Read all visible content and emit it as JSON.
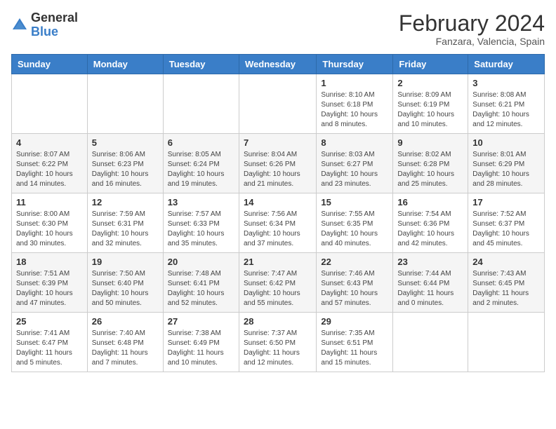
{
  "header": {
    "logo_general": "General",
    "logo_blue": "Blue",
    "month_year": "February 2024",
    "location": "Fanzara, Valencia, Spain"
  },
  "days_of_week": [
    "Sunday",
    "Monday",
    "Tuesday",
    "Wednesday",
    "Thursday",
    "Friday",
    "Saturday"
  ],
  "weeks": [
    [
      {
        "day": "",
        "sunrise": "",
        "sunset": "",
        "daylight": ""
      },
      {
        "day": "",
        "sunrise": "",
        "sunset": "",
        "daylight": ""
      },
      {
        "day": "",
        "sunrise": "",
        "sunset": "",
        "daylight": ""
      },
      {
        "day": "",
        "sunrise": "",
        "sunset": "",
        "daylight": ""
      },
      {
        "day": "1",
        "sunrise": "Sunrise: 8:10 AM",
        "sunset": "Sunset: 6:18 PM",
        "daylight": "Daylight: 10 hours and 8 minutes."
      },
      {
        "day": "2",
        "sunrise": "Sunrise: 8:09 AM",
        "sunset": "Sunset: 6:19 PM",
        "daylight": "Daylight: 10 hours and 10 minutes."
      },
      {
        "day": "3",
        "sunrise": "Sunrise: 8:08 AM",
        "sunset": "Sunset: 6:21 PM",
        "daylight": "Daylight: 10 hours and 12 minutes."
      }
    ],
    [
      {
        "day": "4",
        "sunrise": "Sunrise: 8:07 AM",
        "sunset": "Sunset: 6:22 PM",
        "daylight": "Daylight: 10 hours and 14 minutes."
      },
      {
        "day": "5",
        "sunrise": "Sunrise: 8:06 AM",
        "sunset": "Sunset: 6:23 PM",
        "daylight": "Daylight: 10 hours and 16 minutes."
      },
      {
        "day": "6",
        "sunrise": "Sunrise: 8:05 AM",
        "sunset": "Sunset: 6:24 PM",
        "daylight": "Daylight: 10 hours and 19 minutes."
      },
      {
        "day": "7",
        "sunrise": "Sunrise: 8:04 AM",
        "sunset": "Sunset: 6:26 PM",
        "daylight": "Daylight: 10 hours and 21 minutes."
      },
      {
        "day": "8",
        "sunrise": "Sunrise: 8:03 AM",
        "sunset": "Sunset: 6:27 PM",
        "daylight": "Daylight: 10 hours and 23 minutes."
      },
      {
        "day": "9",
        "sunrise": "Sunrise: 8:02 AM",
        "sunset": "Sunset: 6:28 PM",
        "daylight": "Daylight: 10 hours and 25 minutes."
      },
      {
        "day": "10",
        "sunrise": "Sunrise: 8:01 AM",
        "sunset": "Sunset: 6:29 PM",
        "daylight": "Daylight: 10 hours and 28 minutes."
      }
    ],
    [
      {
        "day": "11",
        "sunrise": "Sunrise: 8:00 AM",
        "sunset": "Sunset: 6:30 PM",
        "daylight": "Daylight: 10 hours and 30 minutes."
      },
      {
        "day": "12",
        "sunrise": "Sunrise: 7:59 AM",
        "sunset": "Sunset: 6:31 PM",
        "daylight": "Daylight: 10 hours and 32 minutes."
      },
      {
        "day": "13",
        "sunrise": "Sunrise: 7:57 AM",
        "sunset": "Sunset: 6:33 PM",
        "daylight": "Daylight: 10 hours and 35 minutes."
      },
      {
        "day": "14",
        "sunrise": "Sunrise: 7:56 AM",
        "sunset": "Sunset: 6:34 PM",
        "daylight": "Daylight: 10 hours and 37 minutes."
      },
      {
        "day": "15",
        "sunrise": "Sunrise: 7:55 AM",
        "sunset": "Sunset: 6:35 PM",
        "daylight": "Daylight: 10 hours and 40 minutes."
      },
      {
        "day": "16",
        "sunrise": "Sunrise: 7:54 AM",
        "sunset": "Sunset: 6:36 PM",
        "daylight": "Daylight: 10 hours and 42 minutes."
      },
      {
        "day": "17",
        "sunrise": "Sunrise: 7:52 AM",
        "sunset": "Sunset: 6:37 PM",
        "daylight": "Daylight: 10 hours and 45 minutes."
      }
    ],
    [
      {
        "day": "18",
        "sunrise": "Sunrise: 7:51 AM",
        "sunset": "Sunset: 6:39 PM",
        "daylight": "Daylight: 10 hours and 47 minutes."
      },
      {
        "day": "19",
        "sunrise": "Sunrise: 7:50 AM",
        "sunset": "Sunset: 6:40 PM",
        "daylight": "Daylight: 10 hours and 50 minutes."
      },
      {
        "day": "20",
        "sunrise": "Sunrise: 7:48 AM",
        "sunset": "Sunset: 6:41 PM",
        "daylight": "Daylight: 10 hours and 52 minutes."
      },
      {
        "day": "21",
        "sunrise": "Sunrise: 7:47 AM",
        "sunset": "Sunset: 6:42 PM",
        "daylight": "Daylight: 10 hours and 55 minutes."
      },
      {
        "day": "22",
        "sunrise": "Sunrise: 7:46 AM",
        "sunset": "Sunset: 6:43 PM",
        "daylight": "Daylight: 10 hours and 57 minutes."
      },
      {
        "day": "23",
        "sunrise": "Sunrise: 7:44 AM",
        "sunset": "Sunset: 6:44 PM",
        "daylight": "Daylight: 11 hours and 0 minutes."
      },
      {
        "day": "24",
        "sunrise": "Sunrise: 7:43 AM",
        "sunset": "Sunset: 6:45 PM",
        "daylight": "Daylight: 11 hours and 2 minutes."
      }
    ],
    [
      {
        "day": "25",
        "sunrise": "Sunrise: 7:41 AM",
        "sunset": "Sunset: 6:47 PM",
        "daylight": "Daylight: 11 hours and 5 minutes."
      },
      {
        "day": "26",
        "sunrise": "Sunrise: 7:40 AM",
        "sunset": "Sunset: 6:48 PM",
        "daylight": "Daylight: 11 hours and 7 minutes."
      },
      {
        "day": "27",
        "sunrise": "Sunrise: 7:38 AM",
        "sunset": "Sunset: 6:49 PM",
        "daylight": "Daylight: 11 hours and 10 minutes."
      },
      {
        "day": "28",
        "sunrise": "Sunrise: 7:37 AM",
        "sunset": "Sunset: 6:50 PM",
        "daylight": "Daylight: 11 hours and 12 minutes."
      },
      {
        "day": "29",
        "sunrise": "Sunrise: 7:35 AM",
        "sunset": "Sunset: 6:51 PM",
        "daylight": "Daylight: 11 hours and 15 minutes."
      },
      {
        "day": "",
        "sunrise": "",
        "sunset": "",
        "daylight": ""
      },
      {
        "day": "",
        "sunrise": "",
        "sunset": "",
        "daylight": ""
      }
    ]
  ]
}
